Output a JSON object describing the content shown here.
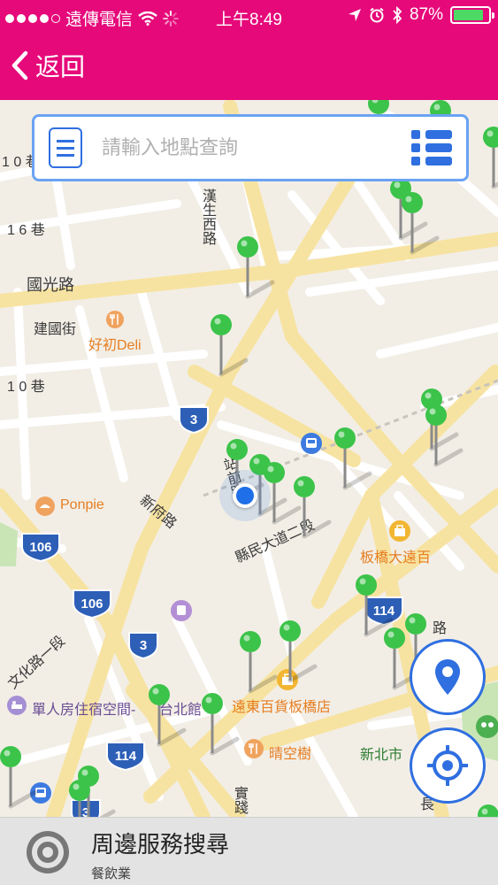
{
  "status_bar": {
    "carrier": "遠傳電信",
    "time": "上午8:49",
    "battery": "87%",
    "battery_level": 0.87
  },
  "nav": {
    "back_label": "返回",
    "color": "#e6097a"
  },
  "search": {
    "placeholder": "請輸入地點查詢"
  },
  "map": {
    "street_labels": [
      "1 0 巷",
      "1 6 巷",
      "漢生西路",
      "國光路",
      "建國街",
      "新府路",
      "站前路",
      "縣民大道二段",
      "文化路一段",
      "實踐",
      "長",
      "路",
      "台北館",
      "1 0 巷",
      "新北市"
    ],
    "poi_labels": {
      "deli": "好初Deli",
      "ponpie": "Ponpie",
      "feg": "板橋大遠百",
      "feg_store": "遠東百貨板橋店",
      "sky_tree": "晴空樹",
      "hostel": "單人房住宿空間-",
      "plaza": "新北市"
    },
    "route_shields": [
      "3",
      "3",
      "3",
      "106",
      "106",
      "114",
      "114",
      "3"
    ]
  },
  "bottom": {
    "title": "周邊服務搜尋",
    "subtitle": "餐飲業"
  },
  "colors": {
    "accent": "#e6097a",
    "blue": "#2f6fe0",
    "pin_green": "#3cc34a",
    "road_yellow": "#f7e3a1"
  }
}
